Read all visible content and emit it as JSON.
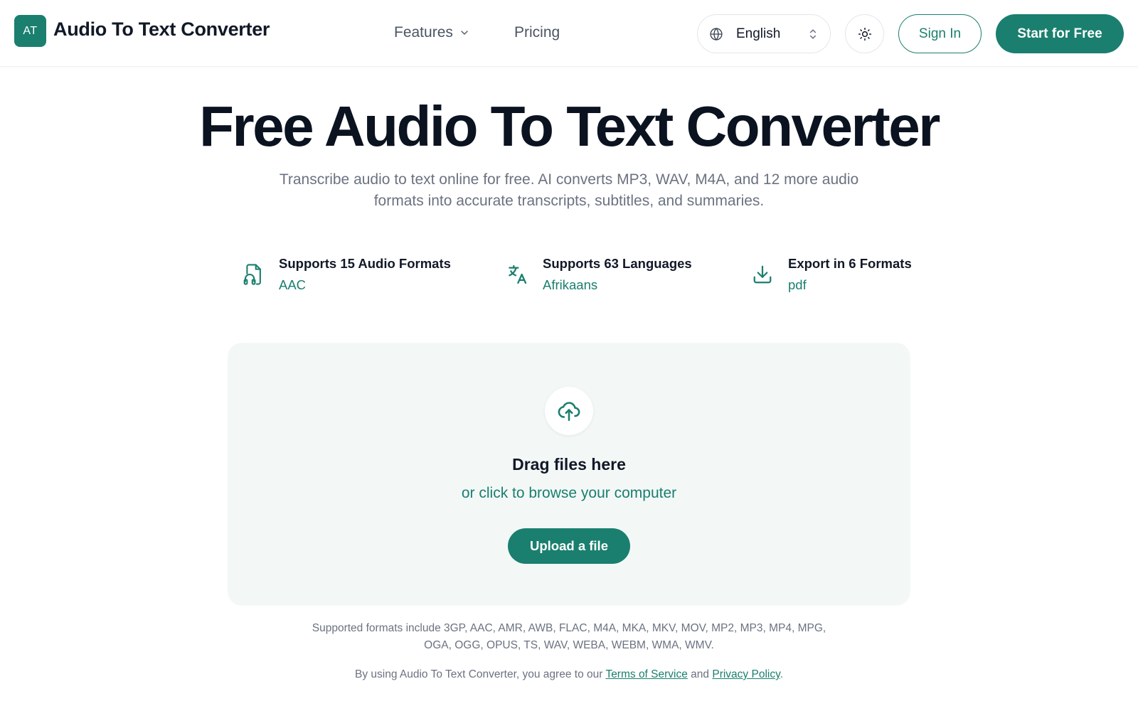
{
  "header": {
    "logo_initials": "AT",
    "brand": "Audio To Text Converter",
    "nav": {
      "features_label": "Features",
      "pricing_label": "Pricing"
    },
    "language": {
      "selected": "English",
      "icon": "globe-icon"
    },
    "theme_icon": "sun-icon",
    "sign_in_label": "Sign In",
    "start_label": "Start for Free"
  },
  "hero": {
    "title": "Free Audio To Text Converter",
    "subtitle": "Transcribe audio to text online for free. AI converts MP3, WAV, M4A, and 12 more audio formats into accurate transcripts, subtitles, and summaries."
  },
  "features": [
    {
      "icon": "audio-file-icon",
      "title": "Supports 15 Audio Formats",
      "value": "AAC"
    },
    {
      "icon": "translate-icon",
      "title": "Supports 63 Languages",
      "value": "Afrikaans"
    },
    {
      "icon": "download-icon",
      "title": "Export in 6 Formats",
      "value": "pdf"
    }
  ],
  "upload": {
    "icon": "cloud-upload-icon",
    "title": "Drag files here",
    "browse_text": "or click to browse your computer",
    "button_label": "Upload a file"
  },
  "formats_note": "Supported formats include 3GP, AAC, AMR, AWB, FLAC, M4A, MKA, MKV, MOV, MP2, MP3, MP4, MPG, OGA, OGG, OPUS, TS, WAV, WEBA, WEBM, WMA, WMV.",
  "terms": {
    "prefix": "By using Audio To Text Converter, you agree to our",
    "tos_label": "Terms of Service",
    "and": "and",
    "privacy_label": "Privacy Policy",
    "suffix": "."
  },
  "colors": {
    "accent": "#1a7f6e",
    "dropzone_bg": "#f3f8f7",
    "muted_text": "#6b7280"
  }
}
